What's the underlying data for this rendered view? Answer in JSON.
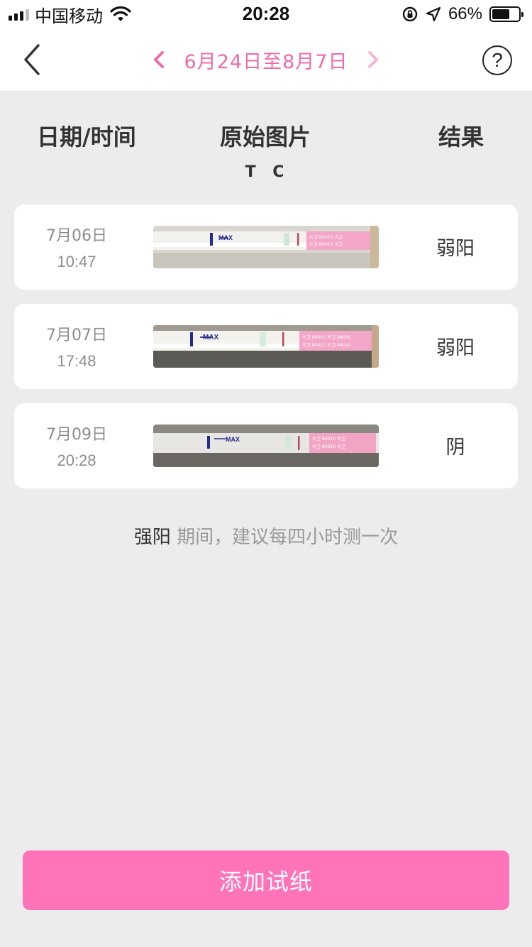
{
  "status_bar": {
    "carrier": "中国移动",
    "time": "20:28",
    "battery_pct": "66%",
    "battery_level": 0.66
  },
  "nav": {
    "date_range": "6月24日至8月7日",
    "help_symbol": "?"
  },
  "table": {
    "header_date": "日期/时间",
    "header_image": "原始图片",
    "header_result": "结果",
    "tc_label": "T C"
  },
  "records": [
    {
      "date": "7月06日",
      "time": "10:47",
      "result": "弱阳",
      "strip_label": "MAX"
    },
    {
      "date": "7月07日",
      "time": "17:48",
      "result": "弱阳",
      "strip_label": "MAX"
    },
    {
      "date": "7月09日",
      "time": "20:28",
      "result": "阴",
      "strip_label": "MAX"
    }
  ],
  "advice": {
    "strong": "强阳",
    "text": " 期间，建议每四小时测一次"
  },
  "add_button_label": "添加试纸",
  "colors": {
    "accent": "#f06aa9",
    "button": "#ff73b8",
    "background": "#ececec"
  }
}
